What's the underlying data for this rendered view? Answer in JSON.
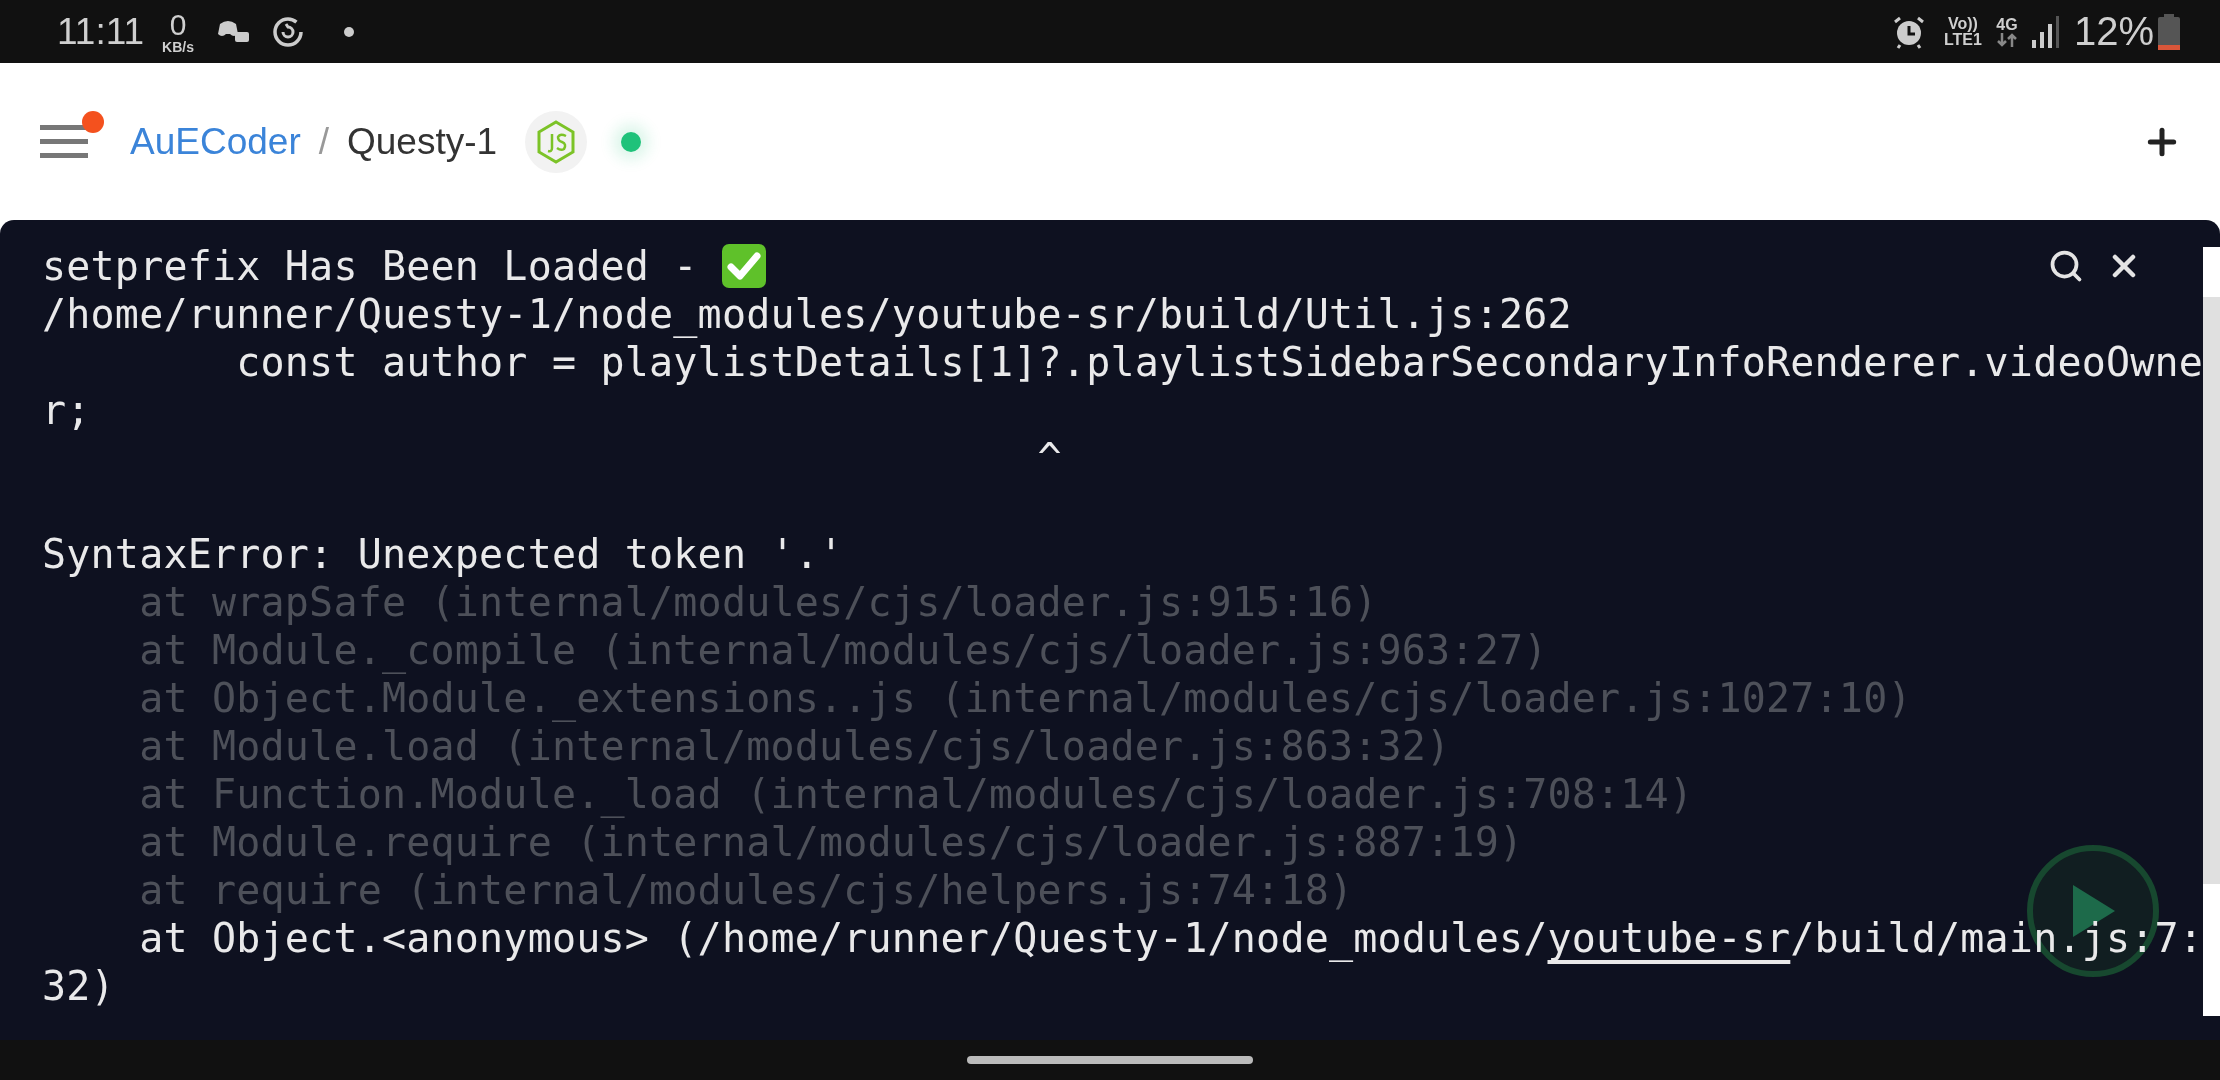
{
  "status_bar": {
    "time": "11:11",
    "speed_value": "0",
    "speed_unit": "KB/s",
    "volte_top": "Vo))",
    "volte_bottom": "LTE1",
    "network": "4G",
    "battery": "12%"
  },
  "header": {
    "owner": "AuECoder",
    "separator": "/",
    "repl": "Questy-1",
    "menu_notification": true,
    "running": true
  },
  "terminal": {
    "lines": [
      {
        "kind": "success",
        "parts": [
          {
            "text": "setprefix Has Been Loaded - ",
            "link": false
          }
        ]
      },
      {
        "kind": "plain",
        "parts": [
          {
            "text": "/home/runner/Questy-1/node_modules/youtube-sr/build/Util.js:262",
            "link": false
          }
        ]
      },
      {
        "kind": "plain",
        "parts": [
          {
            "text": "        const author = playlistDetails[1]?.playlistSidebarSecondaryInfoRenderer.videoOwne",
            "link": false
          }
        ]
      },
      {
        "kind": "plain",
        "parts": [
          {
            "text": "r;",
            "link": false
          }
        ]
      },
      {
        "kind": "plain",
        "parts": [
          {
            "text": "                                         ^",
            "link": false
          }
        ]
      },
      {
        "kind": "blank"
      },
      {
        "kind": "plain",
        "parts": [
          {
            "text": "SyntaxError: Unexpected token '.'",
            "link": false
          }
        ]
      },
      {
        "kind": "dim",
        "parts": [
          {
            "text": "    at wrapSafe (internal/modules/cjs/loader.js:915:16)",
            "link": false
          }
        ]
      },
      {
        "kind": "dim",
        "parts": [
          {
            "text": "    at Module._compile (internal/modules/cjs/loader.js:963:27)",
            "link": false
          }
        ]
      },
      {
        "kind": "dim",
        "parts": [
          {
            "text": "    at Object.Module._extensions..js (internal/modules/cjs/loader.js:1027:10)",
            "link": false
          }
        ]
      },
      {
        "kind": "dim",
        "parts": [
          {
            "text": "    at Module.load (internal/modules/cjs/loader.js:863:32)",
            "link": false
          }
        ]
      },
      {
        "kind": "dim",
        "parts": [
          {
            "text": "    at Function.Module._load (internal/modules/cjs/loader.js:708:14)",
            "link": false
          }
        ]
      },
      {
        "kind": "dim",
        "parts": [
          {
            "text": "    at Module.require (internal/modules/cjs/loader.js:887:19)",
            "link": false
          }
        ]
      },
      {
        "kind": "dim",
        "parts": [
          {
            "text": "    at require (internal/modules/cjs/helpers.js:74:18)",
            "link": false
          }
        ]
      },
      {
        "kind": "plain",
        "parts": [
          {
            "text": "    at Object.<anonymous> (/home/runner/Questy-1/node_modules/",
            "link": false
          },
          {
            "text": "youtube-sr",
            "link": true
          },
          {
            "text": "/build/main.js:7:",
            "link": false
          }
        ]
      },
      {
        "kind": "plain",
        "parts": [
          {
            "text": "32)",
            "link": false
          }
        ]
      }
    ]
  }
}
